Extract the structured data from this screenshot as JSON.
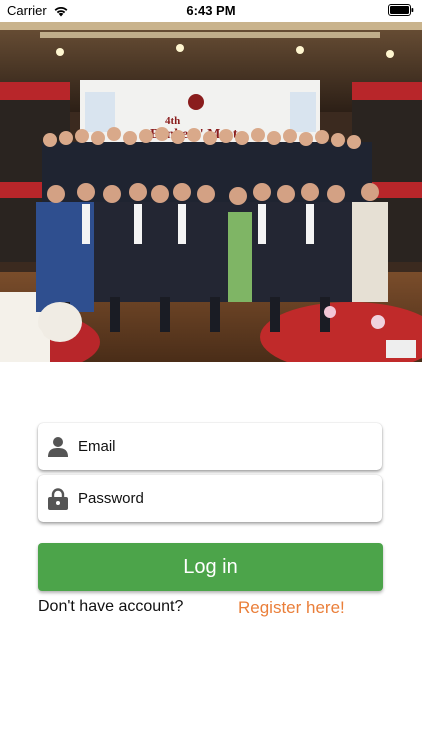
{
  "status_bar": {
    "carrier": "Carrier",
    "time": "6:43 PM"
  },
  "hero": {
    "banner_title": "4th Bankers' Meet",
    "image_description_icon": "group-photo"
  },
  "login_form": {
    "email_placeholder": "Email",
    "password_placeholder": "Password",
    "login_label": "Log in",
    "no_account_text": "Don't have account?",
    "register_label": "Register here!"
  },
  "colors": {
    "login_button": "#4ca44a",
    "register_link": "#ea7f3a",
    "icon_gray": "#555555"
  }
}
